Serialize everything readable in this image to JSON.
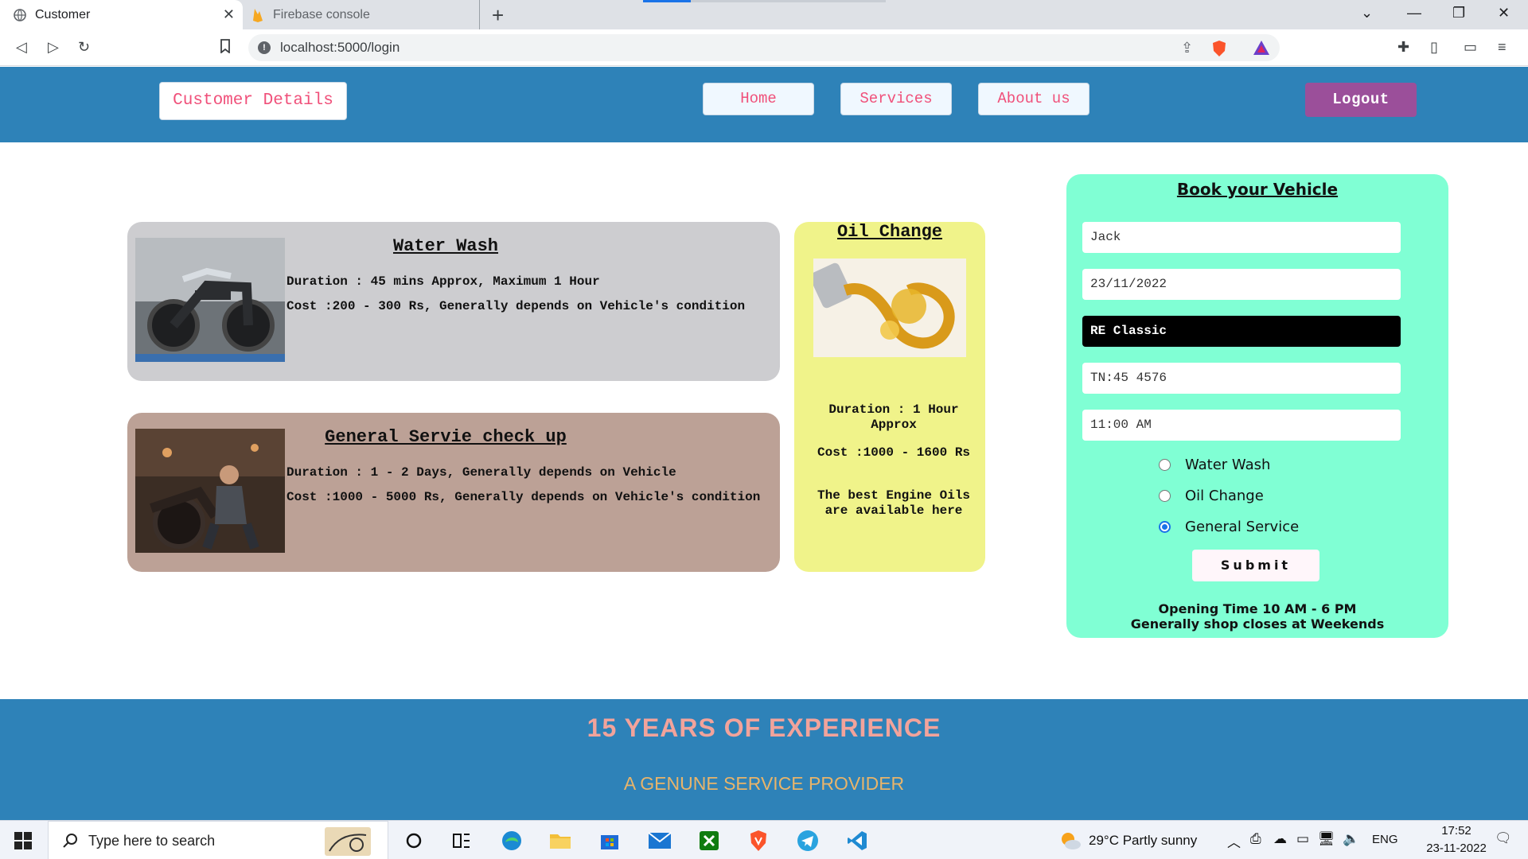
{
  "browser": {
    "tabs": [
      {
        "label": "Customer",
        "active": true
      },
      {
        "label": "Firebase console",
        "active": false
      }
    ],
    "url": "localhost:5000/login"
  },
  "header": {
    "brand": "Customer Details",
    "nav": [
      "Home",
      "Services",
      "About us"
    ],
    "logout": "Logout"
  },
  "services": {
    "water_wash": {
      "title": "Water Wash",
      "duration": "Duration : 45 mins Approx, Maximum 1 Hour",
      "cost": "Cost :200 - 300 Rs, Generally depends on Vehicle's condition"
    },
    "general": {
      "title": "General Servie check up",
      "duration": "Duration : 1 - 2 Days, Generally depends on Vehicle",
      "cost": "Cost :1000 - 5000 Rs, Generally depends on Vehicle's condition"
    },
    "oil": {
      "title": "Oil Change",
      "duration": "Duration : 1 Hour Approx",
      "cost": "Cost :1000 - 1600 Rs",
      "note": "The best Engine Oils are available here"
    }
  },
  "booking": {
    "title": "Book your Vehicle",
    "name": "Jack",
    "date": "23/11/2022",
    "vehicle": "RE Classic",
    "reg_no": "TN:45 4576",
    "time": "11:00 AM",
    "options": [
      {
        "label": "Water Wash",
        "checked": false
      },
      {
        "label": "Oil Change",
        "checked": false
      },
      {
        "label": "General Service",
        "checked": true
      }
    ],
    "submit": "Submit",
    "hours_line1": "Opening Time 10 AM - 6 PM",
    "hours_line2": "Generally shop closes at Weekends"
  },
  "footer": {
    "experience": "15 YEARS OF EXPERIENCE",
    "tagline": "A GENUNE SERVICE PROVIDER"
  },
  "taskbar": {
    "search_placeholder": "Type here to search",
    "weather": "29°C  Partly sunny",
    "language": "ENG",
    "time": "17:52",
    "date": "23-11-2022"
  },
  "colors": {
    "header_bg": "#2e82b8",
    "nav_text": "#f0507a",
    "logout_bg": "#9b4f9a",
    "booking_bg": "#80ffd4",
    "oil_card_bg": "#f0f38a",
    "water_card_bg": "#cdcdd0",
    "general_card_bg": "#bca196"
  }
}
